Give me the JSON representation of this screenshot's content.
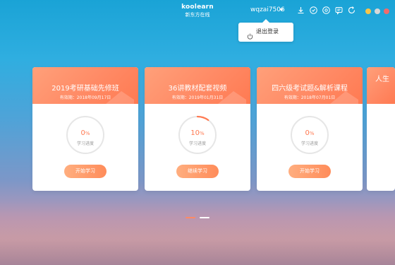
{
  "app": {
    "logo_en": "koolearn",
    "logo_cn": "新东方在线"
  },
  "header": {
    "username": "wqzai7506",
    "icons": [
      "download-icon",
      "refresh-circle-icon",
      "settings-icon",
      "chat-icon",
      "sync-icon"
    ],
    "window_controls": [
      {
        "name": "minimize",
        "color": "#f7c548"
      },
      {
        "name": "maximize",
        "color": "#d7d7d7"
      },
      {
        "name": "close",
        "color": "#f26b6b"
      }
    ]
  },
  "menu": {
    "logout_label": "退出登录"
  },
  "courses": [
    {
      "title": "2019考研基础先修班",
      "expire": "有效期：2018年09月17日",
      "progress": 0,
      "progress_text": "0",
      "unit": "%",
      "progress_label": "学习进度",
      "button": "开始学习"
    },
    {
      "title": "36讲教材配套视频",
      "expire": "有效期：2019年01月31日",
      "progress": 10,
      "progress_text": "10",
      "unit": "%",
      "progress_label": "学习进度",
      "button": "继续学习"
    },
    {
      "title": "四六级考试题&解析课程",
      "expire": "有效期：2018年07月01日",
      "progress": 0,
      "progress_text": "0",
      "unit": "%",
      "progress_label": "学习进度",
      "button": "开始学习"
    },
    {
      "title": "人生"
    }
  ],
  "pagination": {
    "pages": 2,
    "active_index": 0,
    "active_color": "#ff8a65",
    "inactive_color": "#ffffff"
  },
  "colors": {
    "accent": "#ff7a52",
    "ring_track": "#e6e6e6"
  }
}
